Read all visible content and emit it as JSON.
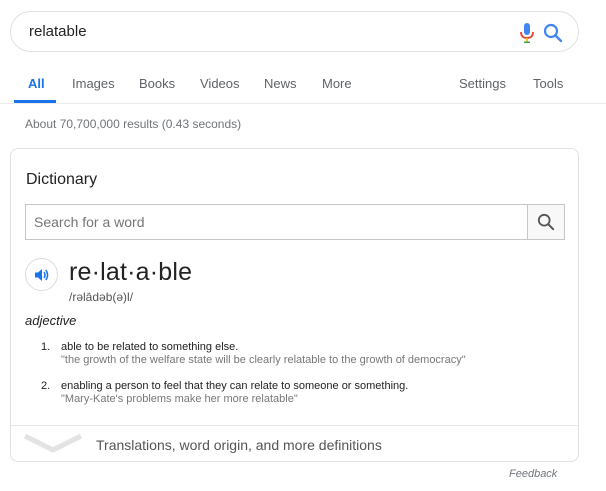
{
  "search": {
    "query": "relatable",
    "mic_icon": "mic-icon",
    "search_icon": "search-icon",
    "colors": {
      "mic_blue": "#4285f4",
      "mic_red": "#ea4335",
      "search_blue": "#4285f4"
    }
  },
  "tabs": {
    "items": [
      {
        "label": "All",
        "active": true
      },
      {
        "label": "Images"
      },
      {
        "label": "Books"
      },
      {
        "label": "Videos"
      },
      {
        "label": "News"
      },
      {
        "label": "More"
      }
    ],
    "right": [
      {
        "label": "Settings"
      },
      {
        "label": "Tools"
      }
    ],
    "accent": "#1a73e8"
  },
  "stats": "About 70,700,000 results (0.43 seconds)",
  "dictionary": {
    "title": "Dictionary",
    "search_placeholder": "Search for a word",
    "search_icon": "search-icon",
    "speaker_icon": "speaker-icon",
    "headword": "re·lat·a·ble",
    "phonetic": "/rəlādəb(ə)l/",
    "part_of_speech": "adjective",
    "definitions": [
      {
        "num": "1.",
        "text": "able to be related to something else.",
        "example": "\"the growth of the welfare state will be clearly relatable to the growth of democracy\""
      },
      {
        "num": "2.",
        "text": "enabling a person to feel that they can relate to someone or something.",
        "example": "\"Mary-Kate's problems make her more relatable\""
      }
    ],
    "more_label": "Translations, word origin, and more definitions",
    "more_icon": "chevron-down-icon"
  },
  "feedback": "Feedback"
}
